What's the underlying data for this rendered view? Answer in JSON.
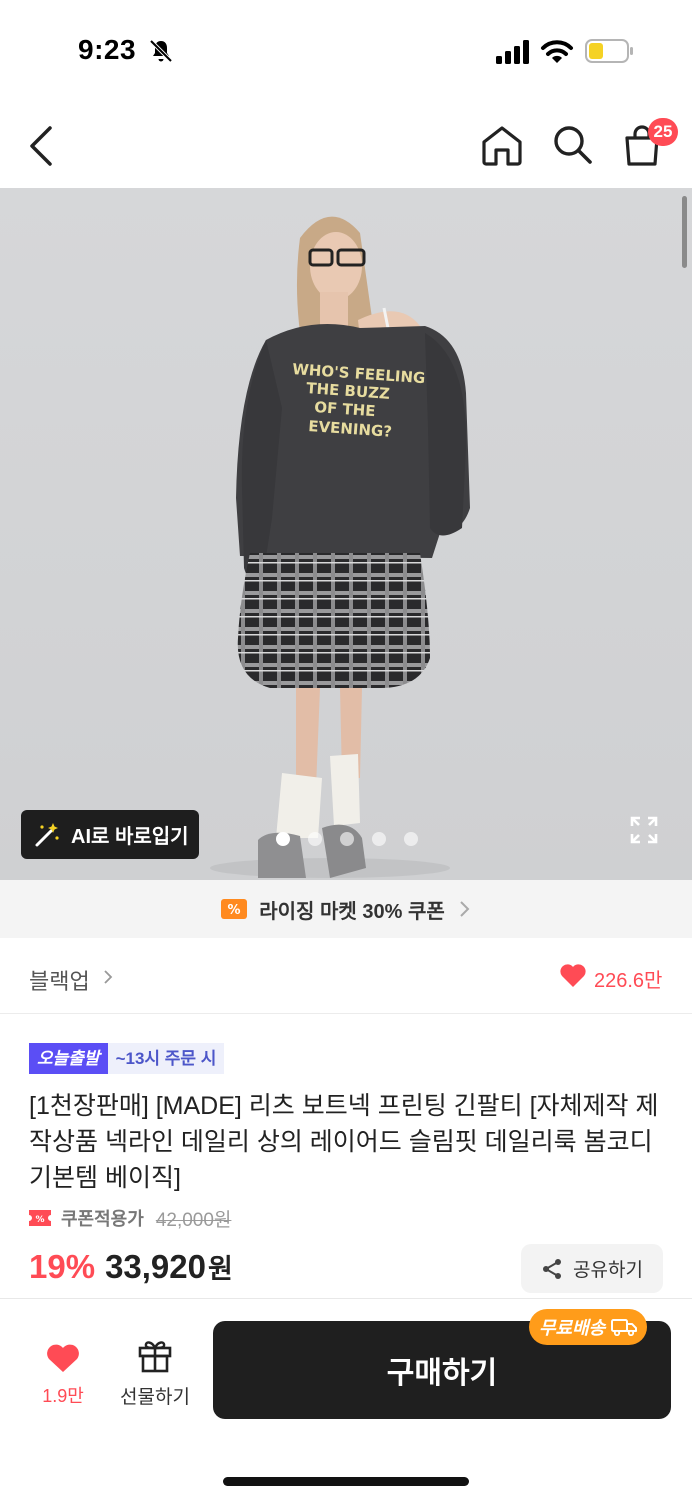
{
  "status_bar": {
    "time": "9:23"
  },
  "nav": {
    "cart_count": "25"
  },
  "hero": {
    "shirt_text": [
      "WHO'S FEELING",
      "THE BUZZ",
      "OF THE",
      "EVENING?"
    ],
    "ai_button_label": "AI로 바로입기",
    "dot_count": 5,
    "active_dot": 0
  },
  "coupon_banner": {
    "text": "라이징 마켓 30% 쿠폰"
  },
  "brand": {
    "name": "블랙업",
    "likes": "226.6만"
  },
  "product": {
    "tag_today": "오늘출발",
    "tag_time": "~13시 주문 시",
    "title": "[1천장판매] [MADE] 리츠 보트넥 프린팅 긴팔티 [자체제작 제작상품 넥라인 데일리 상의 레이어드 슬림핏 데일리룩 봄코디 기본템 베이직]",
    "coupon_label": "쿠폰적용가",
    "original_price": "42,000원",
    "discount": "19%",
    "price": "33,920",
    "currency": "원",
    "share_label": "공유하기"
  },
  "bottom_bar": {
    "wish_count": "1.9만",
    "gift_label": "선물하기",
    "buy_label": "구매하기",
    "free_shipping": "무료배송"
  },
  "colors": {
    "accent": "#ff4b55",
    "today_tag": "#5b4ef5",
    "free_badge": "#ff9c1a",
    "dark": "#1f1f1f"
  }
}
